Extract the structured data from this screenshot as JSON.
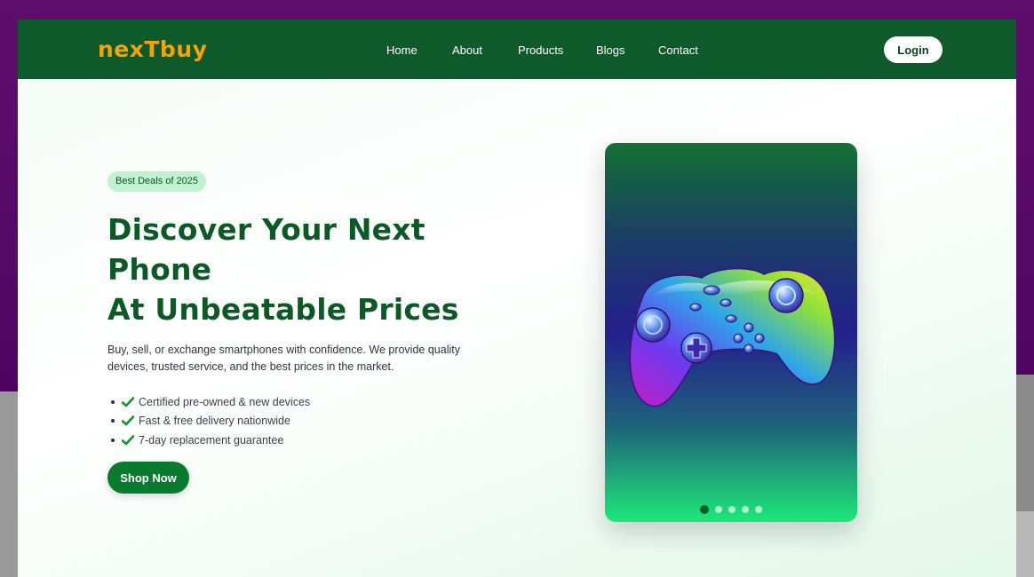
{
  "brand": {
    "logo": "nexTbuy",
    "logo_color": "#f5a10a",
    "nav_bg": "#0f5a2a"
  },
  "nav": {
    "links": [
      "Home",
      "About",
      "Products",
      "Blogs",
      "Contact"
    ],
    "login_label": "Login"
  },
  "hero": {
    "badge": "Best Deals of 2025",
    "title_lines": [
      "Discover Your Next",
      "Phone",
      "At Unbeatable Prices"
    ],
    "description": "Buy, sell, or exchange smartphones with confidence. We provide quality devices, trusted service, and the best prices in the market.",
    "features": [
      "Certified pre-owned & new devices",
      "Fast & free delivery nationwide",
      "7-day replacement guarantee"
    ],
    "cta_label": "Shop Now",
    "accent_color": "#0a7a2e"
  },
  "carousel": {
    "image": "game-controller-icon",
    "slide_count": 5,
    "active_index": 0
  }
}
